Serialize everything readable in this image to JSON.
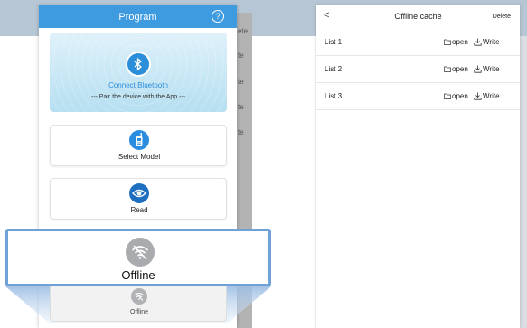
{
  "background": {
    "topbar_color": "#b7c6d4",
    "side_label_fragments": [
      "ete",
      "te",
      "te",
      "te",
      "te"
    ]
  },
  "program_screen": {
    "title": "Program",
    "header_color": "#3f9be0",
    "help_icon": "?",
    "bluetooth": {
      "icon": "bluetooth-icon",
      "title": "Connect Bluetooth",
      "subtitle": "--- Pair the device with the App ---"
    },
    "menu": [
      {
        "label": "Select Model",
        "icon": "walkie-talkie-icon"
      },
      {
        "label": "Read",
        "icon": "eye-icon"
      }
    ],
    "offline_zoom": {
      "label": "Offline",
      "icon": "wifi-off-icon"
    },
    "offline_small": {
      "label": "Offline",
      "icon": "wifi-off-icon"
    }
  },
  "offline_cache_screen": {
    "back_icon": "<",
    "title": "Offline cache",
    "delete_label": "Delete",
    "rows": [
      {
        "name": "List 1",
        "open_label": "open",
        "write_label": "Write"
      },
      {
        "name": "List 2",
        "open_label": "open",
        "write_label": "Write"
      },
      {
        "name": "List 3",
        "open_label": "open",
        "write_label": "Write"
      }
    ]
  }
}
